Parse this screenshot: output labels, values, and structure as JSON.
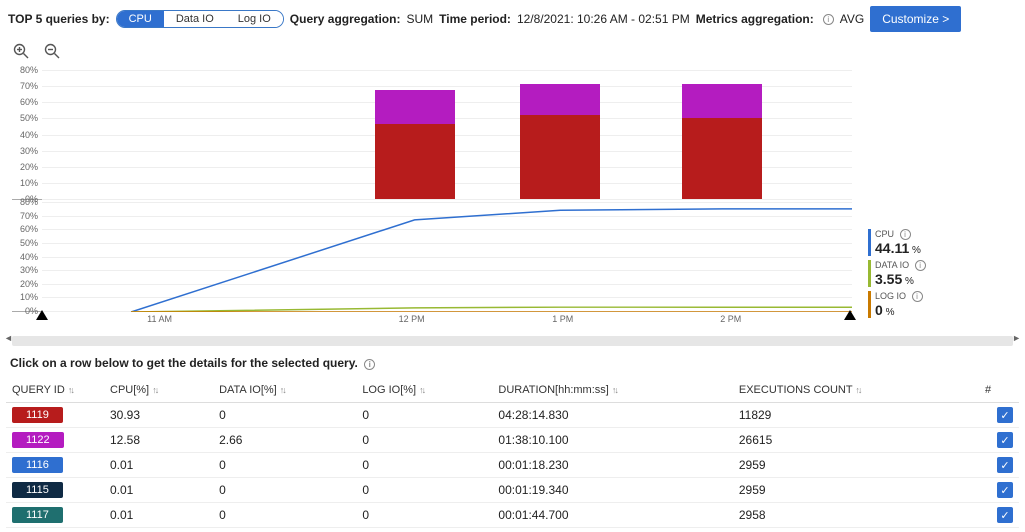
{
  "topbar": {
    "top5_label": "TOP 5 queries by:",
    "pills": {
      "cpu": "CPU",
      "dataio": "Data IO",
      "logio": "Log IO"
    },
    "query_agg_label": "Query aggregation:",
    "query_agg_value": "SUM",
    "time_period_label": "Time period:",
    "time_period_value": "12/8/2021: 10:26 AM - 02:51 PM",
    "metrics_agg_label": "Metrics aggregation:",
    "metrics_agg_value": "AVG",
    "customize_btn": "Customize >"
  },
  "chart_data": [
    {
      "type": "bar",
      "stacked": true,
      "categories": [
        "12 PM",
        "1 PM",
        "2 PM"
      ],
      "series": [
        {
          "name": "1119",
          "color": "#b71c1c",
          "values": [
            46,
            52,
            50
          ]
        },
        {
          "name": "1122",
          "color": "#b41cc0",
          "values": [
            21,
            19,
            21
          ]
        }
      ],
      "ylabel": "%",
      "ylim": [
        0,
        80
      ],
      "yticks": [
        0,
        10,
        20,
        30,
        40,
        50,
        60,
        70,
        80
      ]
    },
    {
      "type": "line",
      "x": [
        "11 AM",
        "12 PM",
        "1 PM",
        "2 PM"
      ],
      "series": [
        {
          "name": "CPU",
          "color": "#2f6fd0",
          "values": [
            0,
            67,
            74,
            75
          ]
        },
        {
          "name": "DATA IO",
          "color": "#98b933",
          "values": [
            0,
            3,
            3.5,
            3.5
          ]
        },
        {
          "name": "LOG IO",
          "color": "#c97a00",
          "values": [
            0,
            0,
            0,
            0
          ]
        }
      ],
      "ylabel": "%",
      "ylim": [
        0,
        80
      ],
      "yticks": [
        0,
        10,
        20,
        30,
        40,
        50,
        60,
        70,
        80
      ]
    }
  ],
  "legend": {
    "cpu": {
      "name": "CPU",
      "value": "44.11",
      "unit": "%",
      "color": "#2f6fd0"
    },
    "dataio": {
      "name": "DATA IO",
      "value": "3.55",
      "unit": "%",
      "color": "#98b933"
    },
    "logio": {
      "name": "LOG IO",
      "value": "0",
      "unit": "%",
      "color": "#c97a00"
    }
  },
  "xaxis": {
    "ticks": [
      "11 AM",
      "12 PM",
      "1 PM",
      "2 PM"
    ]
  },
  "hint": "Click on a row below to get the details for the selected query.",
  "table": {
    "headers": {
      "query_id": "QUERY ID",
      "cpu": "CPU[%]",
      "dataio": "DATA IO[%]",
      "logio": "LOG IO[%]",
      "duration": "DURATION[hh:mm:ss]",
      "exec": "EXECUTIONS COUNT",
      "last": "#"
    },
    "rows": [
      {
        "id": "1119",
        "color": "#b71c1c",
        "cpu": "30.93",
        "dataio": "0",
        "logio": "0",
        "duration": "04:28:14.830",
        "exec": "11829",
        "checked": true
      },
      {
        "id": "1122",
        "color": "#b41cc0",
        "cpu": "12.58",
        "dataio": "2.66",
        "logio": "0",
        "duration": "01:38:10.100",
        "exec": "26615",
        "checked": true
      },
      {
        "id": "1116",
        "color": "#2f6fd0",
        "cpu": "0.01",
        "dataio": "0",
        "logio": "0",
        "duration": "00:01:18.230",
        "exec": "2959",
        "checked": true
      },
      {
        "id": "1115",
        "color": "#0f2a44",
        "cpu": "0.01",
        "dataio": "0",
        "logio": "0",
        "duration": "00:01:19.340",
        "exec": "2959",
        "checked": true
      },
      {
        "id": "1117",
        "color": "#1f6f6f",
        "cpu": "0.01",
        "dataio": "0",
        "logio": "0",
        "duration": "00:01:44.700",
        "exec": "2958",
        "checked": true
      }
    ]
  }
}
